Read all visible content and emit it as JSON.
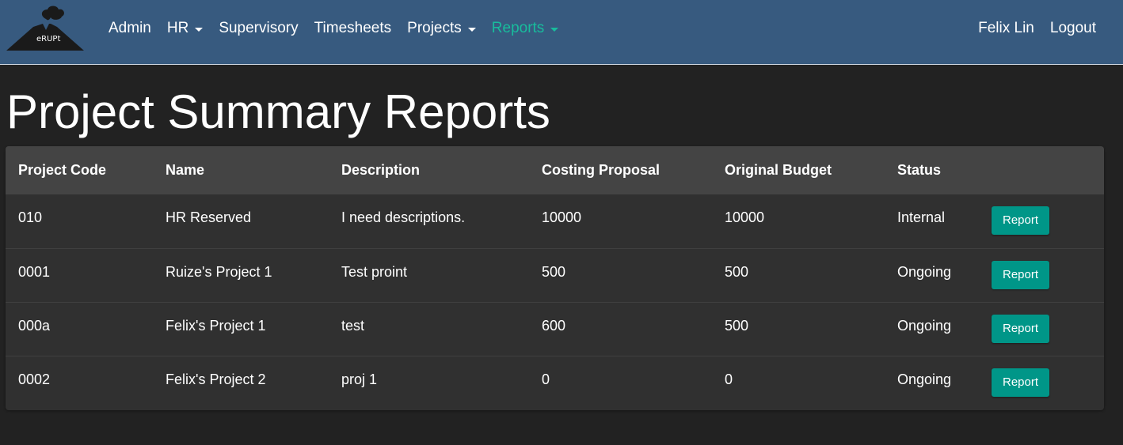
{
  "navbar": {
    "logo_text": "eRUPt",
    "left_items": [
      {
        "label": "Admin",
        "dropdown": false,
        "active": false
      },
      {
        "label": "HR",
        "dropdown": true,
        "active": false
      },
      {
        "label": "Supervisory",
        "dropdown": false,
        "active": false
      },
      {
        "label": "Timesheets",
        "dropdown": false,
        "active": false
      },
      {
        "label": "Projects",
        "dropdown": true,
        "active": false
      },
      {
        "label": "Reports",
        "dropdown": true,
        "active": true
      }
    ],
    "user_name": "Felix Lin",
    "logout_label": "Logout",
    "colors": {
      "background": "#375a7f",
      "active": "#18bc9c"
    }
  },
  "page": {
    "title": "Project Summary Reports"
  },
  "table": {
    "columns": [
      "Project Code",
      "Name",
      "Description",
      "Costing Proposal",
      "Original Budget",
      "Status",
      ""
    ],
    "rows": [
      {
        "code": "010",
        "name": "HR Reserved",
        "description": "I need descriptions.",
        "costing_proposal": "10000",
        "original_budget": "10000",
        "status": "Internal",
        "action": "Report"
      },
      {
        "code": "0001",
        "name": "Ruize's Project 1",
        "description": "Test proint",
        "costing_proposal": "500",
        "original_budget": "500",
        "status": "Ongoing",
        "action": "Report"
      },
      {
        "code": "000a",
        "name": "Felix's Project 1",
        "description": "test",
        "costing_proposal": "600",
        "original_budget": "500",
        "status": "Ongoing",
        "action": "Report"
      },
      {
        "code": "0002",
        "name": "Felix's Project 2",
        "description": "proj 1",
        "costing_proposal": "0",
        "original_budget": "0",
        "status": "Ongoing",
        "action": "Report"
      }
    ],
    "button_color": "#009688"
  }
}
